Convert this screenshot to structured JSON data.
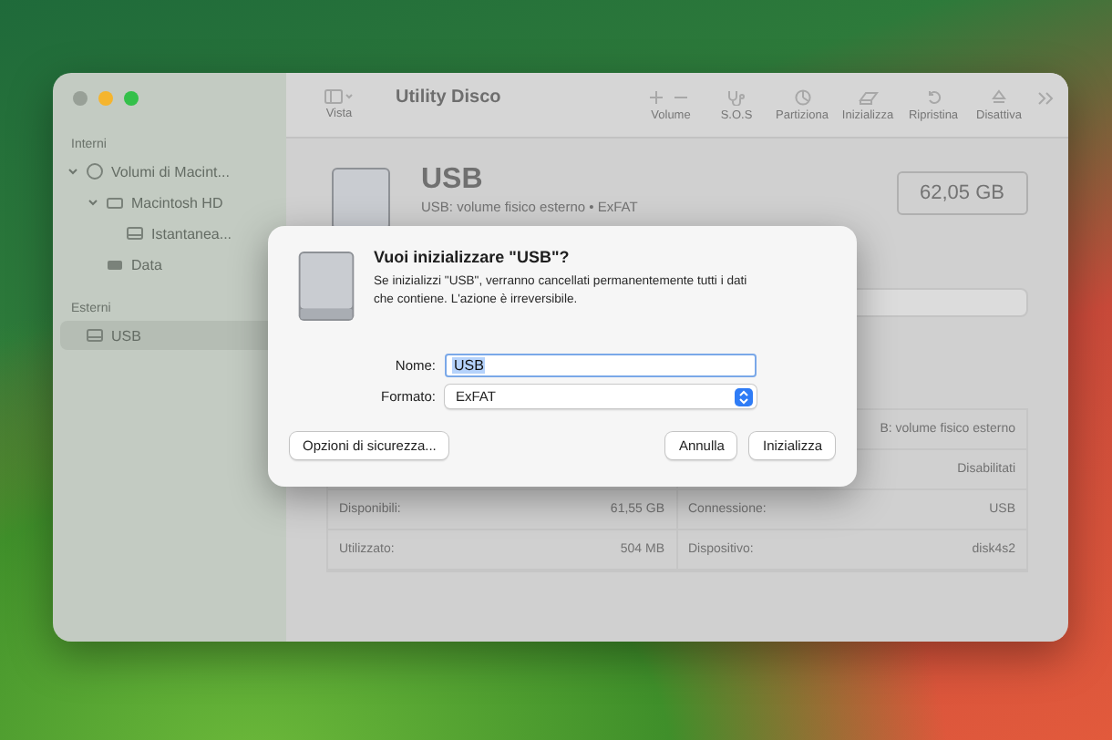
{
  "window": {
    "title": "Utility Disco"
  },
  "toolbar": {
    "view_label": "Vista",
    "items": [
      {
        "kind": "volume",
        "label": "Volume"
      },
      {
        "kind": "sos",
        "label": "S.O.S"
      },
      {
        "kind": "partition",
        "label": "Partiziona"
      },
      {
        "kind": "erase",
        "label": "Inizializza"
      },
      {
        "kind": "restore",
        "label": "Ripristina"
      },
      {
        "kind": "eject",
        "label": "Disattiva"
      }
    ]
  },
  "sidebar": {
    "sections": [
      {
        "title": "Interni",
        "items": [
          {
            "label": "Volumi di Macint...",
            "kind": "stack",
            "expanded": true,
            "selected": false,
            "children": [
              {
                "label": "Macintosh HD",
                "kind": "volume",
                "expanded": true,
                "selected": false,
                "children": [
                  {
                    "label": "Istantanea...",
                    "kind": "disk",
                    "selected": false
                  }
                ]
              },
              {
                "label": "Data",
                "kind": "drive",
                "selected": false
              }
            ]
          }
        ]
      },
      {
        "title": "Esterni",
        "items": [
          {
            "label": "USB",
            "kind": "disk",
            "selected": true
          }
        ]
      }
    ]
  },
  "disk": {
    "name": "USB",
    "subtitle": "USB: volume fisico esterno • ExFAT",
    "size": "62,05 GB"
  },
  "info_rows": [
    {
      "left_label": "",
      "left_value": "",
      "right_label": "",
      "right_value": "B: volume fisico esterno"
    },
    {
      "left_label": "",
      "left_value": "",
      "right_label": "",
      "right_value": "Disabilitati"
    },
    {
      "left_label": "Disponibili:",
      "left_value": "61,55 GB",
      "right_label": "Connessione:",
      "right_value": "USB"
    },
    {
      "left_label": "Utilizzato:",
      "left_value": "504 MB",
      "right_label": "Dispositivo:",
      "right_value": "disk4s2"
    }
  ],
  "dialog": {
    "title": "Vuoi inizializzare \"USB\"?",
    "message": "Se inizializzi \"USB\", verranno cancellati permanentemente tutti i dati che contiene. L'azione è irreversibile.",
    "name_label": "Nome:",
    "name_value": "USB",
    "format_label": "Formato:",
    "format_value": "ExFAT",
    "buttons": [
      {
        "label": "Opzioni di sicurezza...",
        "default": false
      },
      {
        "label": "Annulla",
        "default": false
      },
      {
        "label": "Inizializza",
        "default": false
      }
    ]
  }
}
